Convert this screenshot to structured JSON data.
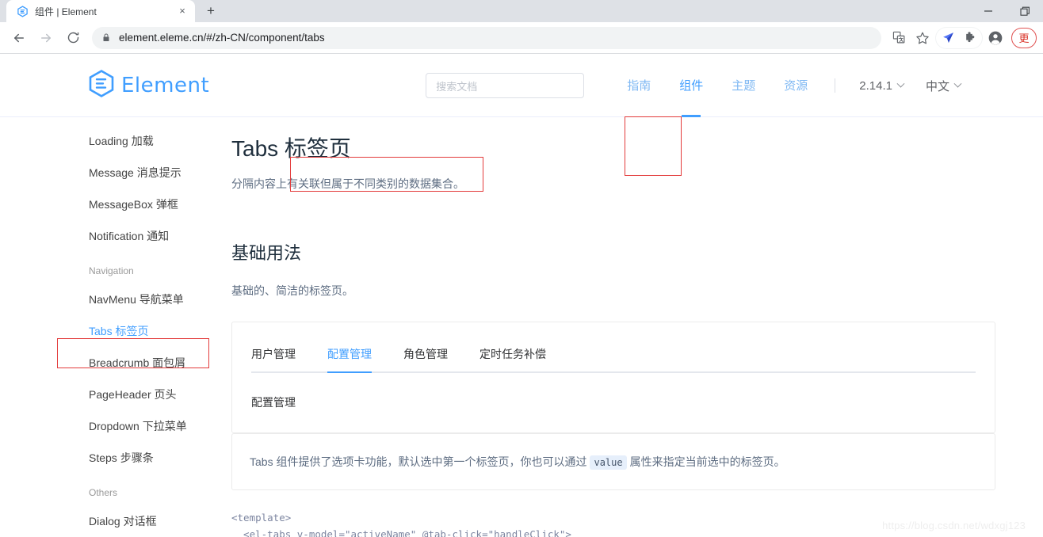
{
  "browser": {
    "tab": {
      "title": "组件 | Element",
      "favicon_icon": "element-logo-icon",
      "close_icon": "×"
    },
    "new_tab_label": "+",
    "window_controls": {
      "minimize": "—",
      "maximize": "❐",
      "close": "✕"
    },
    "toolbar": {
      "back_icon": "arrow-left-icon",
      "forward_icon": "arrow-right-icon",
      "reload_icon": "reload-icon",
      "lock_icon": "lock-icon",
      "url": "element.eleme.cn/#/zh-CN/component/tabs",
      "translate_icon": "translate-icon",
      "bookmark_icon": "star-icon",
      "extension1_icon": "paper-plane-icon",
      "extension2_icon": "puzzle-piece-icon",
      "profile_icon": "account-avatar-icon",
      "more_label": "更"
    }
  },
  "site_header": {
    "logo_text": "Element",
    "search": {
      "placeholder": "搜索文档",
      "value": ""
    },
    "nav": [
      {
        "label": "指南",
        "active": false
      },
      {
        "label": "组件",
        "active": true
      },
      {
        "label": "主题",
        "active": false
      },
      {
        "label": "资源",
        "active": false
      }
    ],
    "version": "2.14.1",
    "language": "中文"
  },
  "sidebar": {
    "items": [
      {
        "type": "link",
        "label": "Loading 加载",
        "active": false
      },
      {
        "type": "link",
        "label": "Message 消息提示",
        "active": false
      },
      {
        "type": "link",
        "label": "MessageBox 弹框",
        "active": false
      },
      {
        "type": "link",
        "label": "Notification 通知",
        "active": false
      },
      {
        "type": "group",
        "label": "Navigation"
      },
      {
        "type": "link",
        "label": "NavMenu 导航菜单",
        "active": false
      },
      {
        "type": "link",
        "label": "Tabs 标签页",
        "active": true
      },
      {
        "type": "link",
        "label": "Breadcrumb 面包屑",
        "active": false
      },
      {
        "type": "link",
        "label": "PageHeader 页头",
        "active": false
      },
      {
        "type": "link",
        "label": "Dropdown 下拉菜单",
        "active": false
      },
      {
        "type": "link",
        "label": "Steps 步骤条",
        "active": false
      },
      {
        "type": "group",
        "label": "Others"
      },
      {
        "type": "link",
        "label": "Dialog 对话框",
        "active": false
      }
    ]
  },
  "main": {
    "title": "Tabs 标签页",
    "subtitle": "分隔内容上有关联但属于不同类别的数据集合。",
    "section_title": "基础用法",
    "section_desc": "基础的、简洁的标签页。",
    "demo": {
      "tabs": [
        {
          "label": "用户管理",
          "active": false
        },
        {
          "label": "配置管理",
          "active": true
        },
        {
          "label": "角色管理",
          "active": false
        },
        {
          "label": "定时任务补偿",
          "active": false
        }
      ],
      "panel_text": "配置管理"
    },
    "tip": {
      "text_before": "Tabs 组件提供了选项卡功能，默认选中第一个标签页，你也可以通过",
      "code": "value",
      "text_after": "属性来指定当前选中的标签页。"
    },
    "code_lines": [
      "<template>",
      "  <el-tabs v-model=\"activeName\" @tab-click=\"handleClick\">"
    ]
  },
  "watermark": "https://blog.csdn.net/wdxgj123",
  "colors": {
    "accent": "#409eff",
    "annotation_red": "#e33b3b",
    "text_primary": "#1f2f3d",
    "text_secondary": "#5e6d82",
    "tab_border": "#e4e7ed"
  }
}
